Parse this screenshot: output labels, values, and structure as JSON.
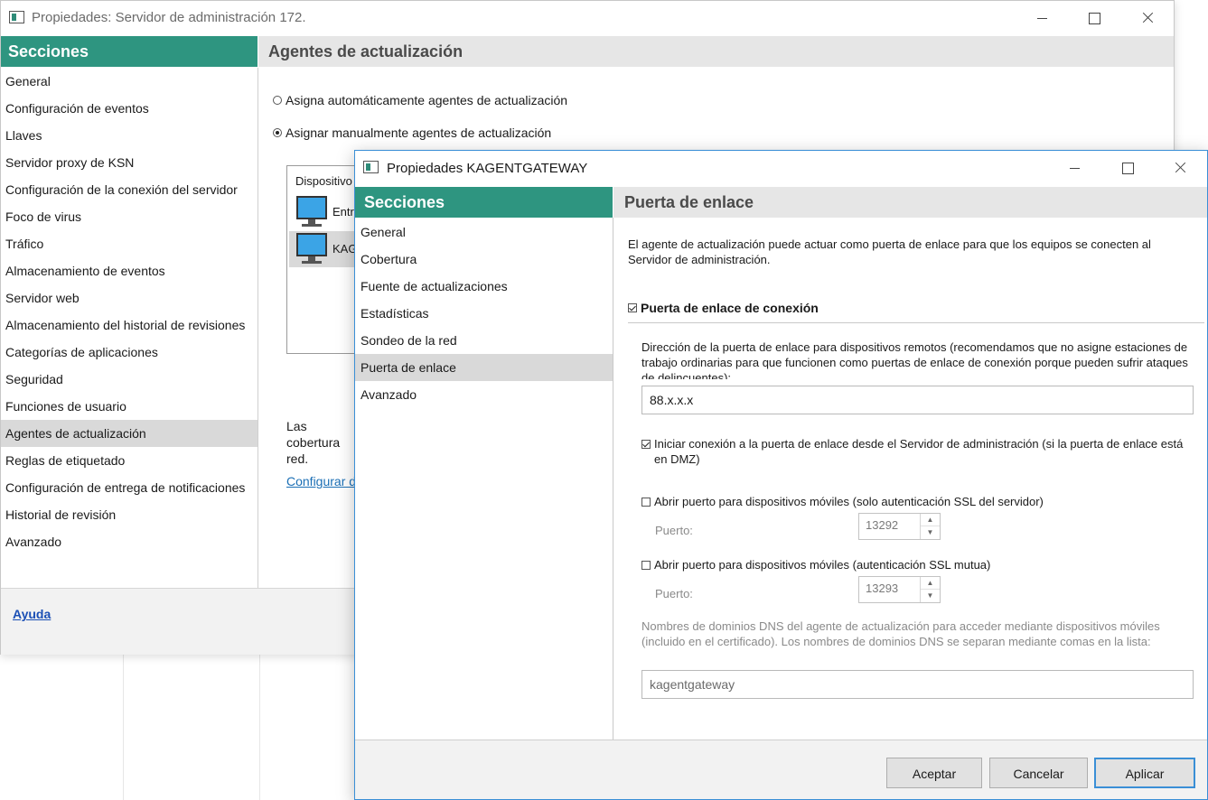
{
  "parent_window": {
    "title": "Propiedades: Servidor de administración 172.",
    "sections_header": "Secciones",
    "sections": [
      "General",
      "Configuración de eventos",
      "Llaves",
      "Servidor proxy de KSN",
      "Configuración de la conexión del servidor",
      "Foco de virus",
      "Tráfico",
      "Almacenamiento de eventos",
      "Servidor web",
      "Almacenamiento del historial de revisiones",
      "Categorías de aplicaciones",
      "Seguridad",
      "Funciones de usuario",
      "Agentes de actualización",
      "Reglas de etiquetado",
      "Configuración de entrega de notificaciones",
      "Historial de revisión",
      "Avanzado"
    ],
    "active_section": "Agentes de actualización",
    "pane_title": "Agentes de actualización",
    "radio_auto": "Asigna automáticamente agentes de actualización",
    "radio_manual": "Asignar manualmente agentes de actualización",
    "device_column": "Dispositivo",
    "devices": [
      "Entra",
      "KAGI"
    ],
    "coverage_text": "Las cobertura red.",
    "config_link": "Configurar de",
    "help_link": "Ayuda"
  },
  "dialog": {
    "title": "Propiedades KAGENTGATEWAY",
    "sections_header": "Secciones",
    "sections": [
      "General",
      "Cobertura",
      "Fuente de actualizaciones",
      "Estadísticas",
      "Sondeo de la red",
      "Puerta de enlace",
      "Avanzado"
    ],
    "active_section": "Puerta de enlace",
    "pane_title": "Puerta de enlace",
    "description": "El agente de actualización puede actuar como puerta de enlace para que los equipos se conecten al Servidor de administración.",
    "gateway_checkbox": "Puerta de enlace de conexión",
    "address_label": "Dirección de la puerta de enlace para dispositivos remotos (recomendamos que no asigne estaciones de trabajo ordinarias para que funcionen como puertas de enlace de conexión porque pueden sufrir ataques de delincuentes):",
    "address_value": "88.x.x.x",
    "initiate_connection": "Iniciar conexión a la puerta de enlace desde el Servidor de administración (si la puerta de enlace está en DMZ)",
    "open_port_ssl_server": "Abrir puerto para dispositivos móviles (solo autenticación SSL del servidor)",
    "port_label": "Puerto:",
    "port_ssl_server": "13292",
    "open_port_ssl_mutual": "Abrir puerto para dispositivos móviles (autenticación SSL mutua)",
    "port_ssl_mutual": "13293",
    "dns_label": "Nombres de dominios DNS del agente de actualización para acceder mediante dispositivos móviles (incluido en el certificado). Los nombres de dominios DNS se separan mediante comas en la lista:",
    "dns_value": "kagentgateway",
    "buttons": {
      "accept": "Aceptar",
      "cancel": "Cancelar",
      "apply": "Aplicar"
    }
  },
  "colors": {
    "section_header": "#2e9580",
    "selection": "#d9d9d9",
    "link": "#1b4fb5",
    "dialog_border": "#3a8fd6"
  }
}
